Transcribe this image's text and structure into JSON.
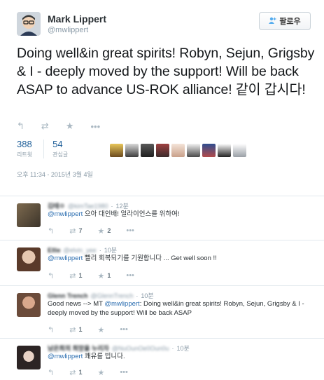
{
  "main_tweet": {
    "author_name": "Mark Lippert",
    "author_handle": "@mwlippert",
    "follow_label": "팔로우",
    "text": "Doing well&in great spirits! Robyn, Sejun, Grigsby & I - deeply moved by the support! Will be back ASAP to advance US-ROK alliance! 같이 갑시다!",
    "retweets_value": "388",
    "retweets_label": "리트윗",
    "favorites_value": "54",
    "favorites_label": "관심글",
    "timestamp": "오후 11:34 - 2015년 3월 4일"
  },
  "icons": {
    "reply": "reply-arrow-icon",
    "retweet": "retweet-icon",
    "favorite": "star-icon",
    "more": "more-dots-icon",
    "follow": "add-user-icon"
  },
  "replies": [
    {
      "name": "김태ㅇ",
      "handle": "@kimTae1980",
      "time": "12분",
      "mention": "@mwlippert",
      "text": " 으아 대인배! 얼라이언스를 위하여!",
      "retweets": "7",
      "favorites": "2"
    },
    {
      "name": "Ellie",
      "handle": "@elvin_yee",
      "time": "10분",
      "mention": "@mwlippert",
      "text": " 빨리 회복되기를 기원합니다 ... Get well soon !!",
      "retweets": "1",
      "favorites": "1"
    },
    {
      "name": "Glenn Trench",
      "handle": "@GlennTrench",
      "time": "10분",
      "prefix": "Good news --> MT ",
      "mention": "@mwlippert",
      "text": ": Doing well&in great spirits! Robyn, Sejun, Grigsby & I - deeply moved by the support! Will be back ASAP",
      "retweets": "1",
      "favorites": ""
    },
    {
      "name": "남은희의 희망을 누리자",
      "handle": "@NuOunOe0Oun0u",
      "time": "10분",
      "mention": "@mwlippert",
      "text": " 쾌유를 빕니다.",
      "retweets": "1",
      "favorites": ""
    }
  ]
}
